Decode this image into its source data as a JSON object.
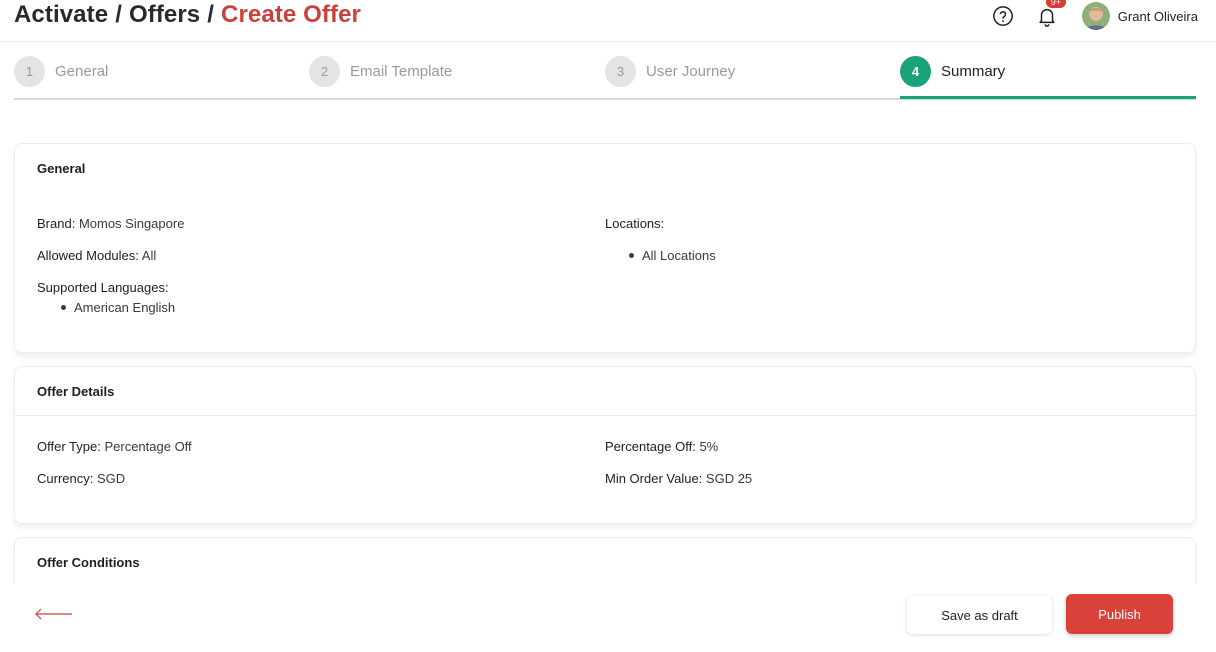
{
  "breadcrumb": {
    "items": [
      "Activate",
      "Offers"
    ],
    "separator": "/",
    "current": "Create Offer"
  },
  "header": {
    "help_icon": "help-circle-icon",
    "notification_icon": "bell-icon",
    "notification_badge": "9+",
    "user_name": "Grant Oliveira"
  },
  "stepper": {
    "steps": [
      {
        "number": "1",
        "label": "General",
        "active": false
      },
      {
        "number": "2",
        "label": "Email Template",
        "active": false
      },
      {
        "number": "3",
        "label": "User Journey",
        "active": false
      },
      {
        "number": "4",
        "label": "Summary",
        "active": true
      }
    ]
  },
  "general": {
    "title": "General",
    "brand_label": "Brand:",
    "brand_value": "Momos Singapore",
    "modules_label": "Allowed Modules:",
    "modules_value": "All",
    "languages_label": "Supported Languages:",
    "languages": [
      "American English"
    ],
    "locations_label": "Locations:",
    "locations": [
      "All Locations"
    ]
  },
  "offer_details": {
    "title": "Offer Details",
    "offer_type_label": "Offer Type:",
    "offer_type_value": "Percentage Off",
    "currency_label": "Currency:",
    "currency_value": "SGD",
    "percentage_label": "Percentage Off:",
    "percentage_value": "5%",
    "min_order_label": "Min Order Value:",
    "min_order_value": "SGD 25"
  },
  "offer_conditions": {
    "title": "Offer Conditions"
  },
  "footer": {
    "back_icon": "arrow-left-icon",
    "save_draft_label": "Save as draft",
    "publish_label": "Publish"
  },
  "colors": {
    "accent_red": "#d9413a",
    "breadcrumb_active": "#c9423a",
    "step_active": "#1aa37a"
  }
}
